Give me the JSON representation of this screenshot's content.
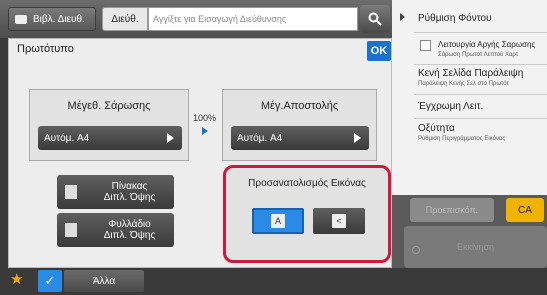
{
  "topbar": {
    "address_book_label": "Βιβλ. Διευθ.",
    "address_tab_label": "Διεύθ.",
    "address_input_placeholder": "Αγγίξτε για Εισαγωγή Διεύθυνσης"
  },
  "dialog": {
    "title": "Πρωτότυπο",
    "ok_label": "OK",
    "scan_size": {
      "title": "Μέγεθ. Σάρωσης",
      "value": "Αυτόμ.   A4"
    },
    "ratio": "100%",
    "send_size": {
      "title": "Μέγ.Αποστολής",
      "value": "Αυτόμ.   A4"
    },
    "book_button": {
      "line1": "Πίνακας",
      "line2": "Διπλ. Όψης"
    },
    "booklet_button": {
      "line1": "Φυλλάδιο",
      "line2": "Διπλ. Όψης"
    },
    "orientation": {
      "title": "Προσανατολισμός Εικόνας",
      "option_a_glyph": "A",
      "option_b_glyph": "<"
    }
  },
  "right_menu": {
    "items": [
      {
        "label": "Ρύθμιση Φόντου",
        "sub": ""
      },
      {
        "label": "Λειτουργία Αργής Σαρωσης",
        "sub": "Σάρωση Πρωτοτ Λεπτού Χαρτ"
      },
      {
        "label": "Κενή Σελίδα Παράλειψη",
        "sub": "Παράλειψη Κενής Σελ στο Πρωτότ"
      },
      {
        "label": "Έγχρωμη Λειτ.",
        "sub": ""
      },
      {
        "label": "Οξύτητα",
        "sub": "Ρύθμιση Περιγράμματος Εικόνας"
      }
    ]
  },
  "actions": {
    "preview_label": "Προεπισκόπ.",
    "ca_label": "CA",
    "start_label": "Εκκίνηση"
  },
  "bottombar": {
    "other_label": "Άλλα"
  },
  "colors": {
    "accent": "#1a73c9",
    "highlight": "#d0183a",
    "ca": "#f0b400"
  }
}
